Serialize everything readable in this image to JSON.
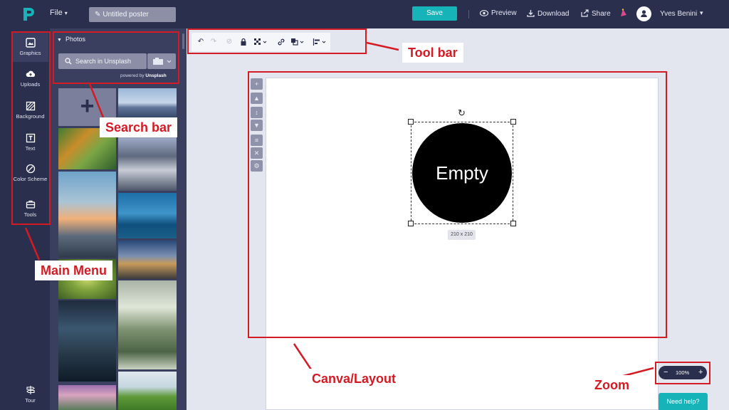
{
  "topbar": {
    "file_label": "File",
    "title_value": "Untitled poster",
    "save_label": "Save",
    "preview_label": "Preview",
    "download_label": "Download",
    "share_label": "Share",
    "username": "Yves Benini"
  },
  "main_menu": {
    "items": [
      {
        "label": "Graphics",
        "icon": "image-icon"
      },
      {
        "label": "Uploads",
        "icon": "cloud-upload-icon"
      },
      {
        "label": "Background",
        "icon": "hatch-icon"
      },
      {
        "label": "Text",
        "icon": "text-box-icon"
      },
      {
        "label": "Color Scheme",
        "icon": "palette-icon"
      },
      {
        "label": "Tools",
        "icon": "toolbox-icon"
      }
    ],
    "tour_label": "Tour"
  },
  "panel": {
    "section_label": "Photos",
    "search_placeholder": "Search in Unsplash",
    "powered_prefix": "powered by",
    "powered_brand": "Unsplash"
  },
  "canvas": {
    "element_text": "Empty",
    "size_label": "210 x 210"
  },
  "zoom": {
    "minus": "−",
    "level": "100%",
    "plus": "+"
  },
  "help_label": "Need help?",
  "annotations": {
    "tool_bar": "Tool bar",
    "search_bar": "Search bar",
    "main_menu": "Main Menu",
    "canva_layout": "Canva/Layout",
    "zoom": "Zoom"
  },
  "colors": {
    "dark_navy": "#2b2f4e",
    "panel": "#3a3e5f",
    "teal": "#16b3b8",
    "annotation_red": "#d41b24"
  }
}
